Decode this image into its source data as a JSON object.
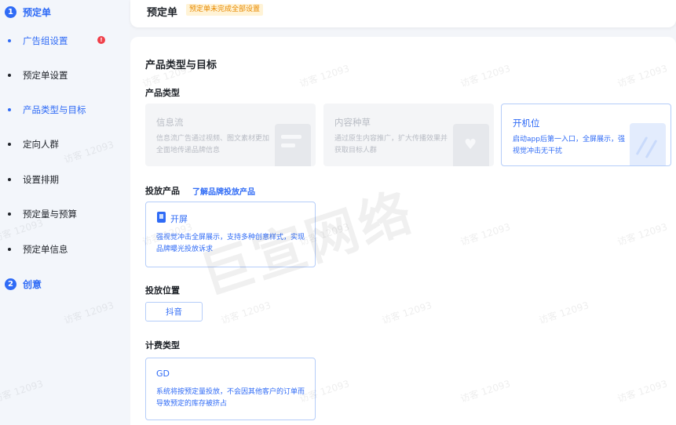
{
  "sidebar": {
    "steps": [
      {
        "num": "1",
        "label": "预定单"
      },
      {
        "num": "2",
        "label": "创意"
      }
    ],
    "items": [
      {
        "label": "广告组设置",
        "error": "!"
      },
      {
        "label": "预定单设置"
      },
      {
        "label": "产品类型与目标"
      },
      {
        "label": "定向人群"
      },
      {
        "label": "设置排期"
      },
      {
        "label": "预定量与预算"
      },
      {
        "label": "预定单信息"
      }
    ]
  },
  "header": {
    "title": "预定单",
    "warning": "预定单未完成全部设置"
  },
  "main": {
    "section_title": "产品类型与目标",
    "product_type": {
      "label": "产品类型",
      "cards": [
        {
          "title": "信息流",
          "desc": "信息流广告通过视频、图文素材更加全面地传递品牌信息",
          "state": "disabled"
        },
        {
          "title": "内容种草",
          "desc": "通过原生内容推广，扩大传播效果并获取目标人群",
          "state": "disabled"
        },
        {
          "title": "开机位",
          "desc": "启动app后第一入口，全屏展示，强视觉冲击无干扰",
          "state": "selected"
        }
      ]
    },
    "delivery_product": {
      "label": "投放产品",
      "link": "了解品牌投放产品",
      "card": {
        "title": "开屏",
        "desc": "强视觉冲击全屏展示，支持多种创意样式，实现品牌曝光投放诉求"
      }
    },
    "placement": {
      "label": "投放位置",
      "value": "抖音"
    },
    "billing": {
      "label": "计费类型",
      "card": {
        "title": "GD",
        "desc": "系统将按预定量投放，不会因其他客户的订单而导致预定的库存被挤占"
      }
    }
  },
  "watermark": {
    "big": "巨宣网络",
    "small": "访客 12093"
  },
  "colors": {
    "accent": "#2f6bf6",
    "warning": "#e88a00",
    "error": "#f0404a"
  }
}
